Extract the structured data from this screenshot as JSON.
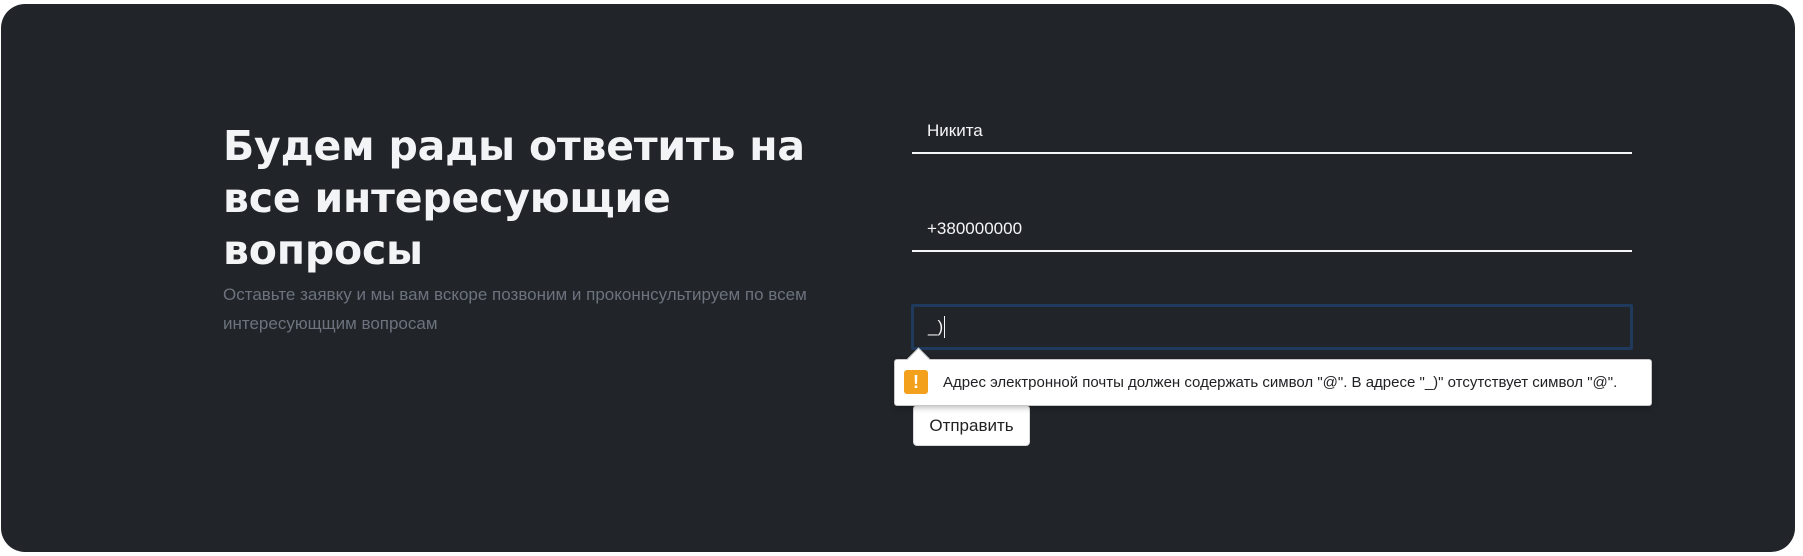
{
  "section": {
    "heading": "Будем рады ответить на все интересующие вопросы",
    "subtext": "Оставьте заявку и мы вам вскоре позвоним и проконнсультируем по всем интересующщим вопросам"
  },
  "form": {
    "name_value": "Никита",
    "phone_value": "+380000000",
    "email_value": "_)",
    "submit_label": "Отправить"
  },
  "validation": {
    "icon": "warning-icon",
    "icon_glyph": "!",
    "message": "Адрес электронной почты должен содержать символ \"@\". В адресе \"_)\" отсутствует символ \"@\".",
    "icon_color": "#f3a11c"
  },
  "colors": {
    "panel_background": "#212429",
    "email_focus_border": "#1f3a5d"
  }
}
